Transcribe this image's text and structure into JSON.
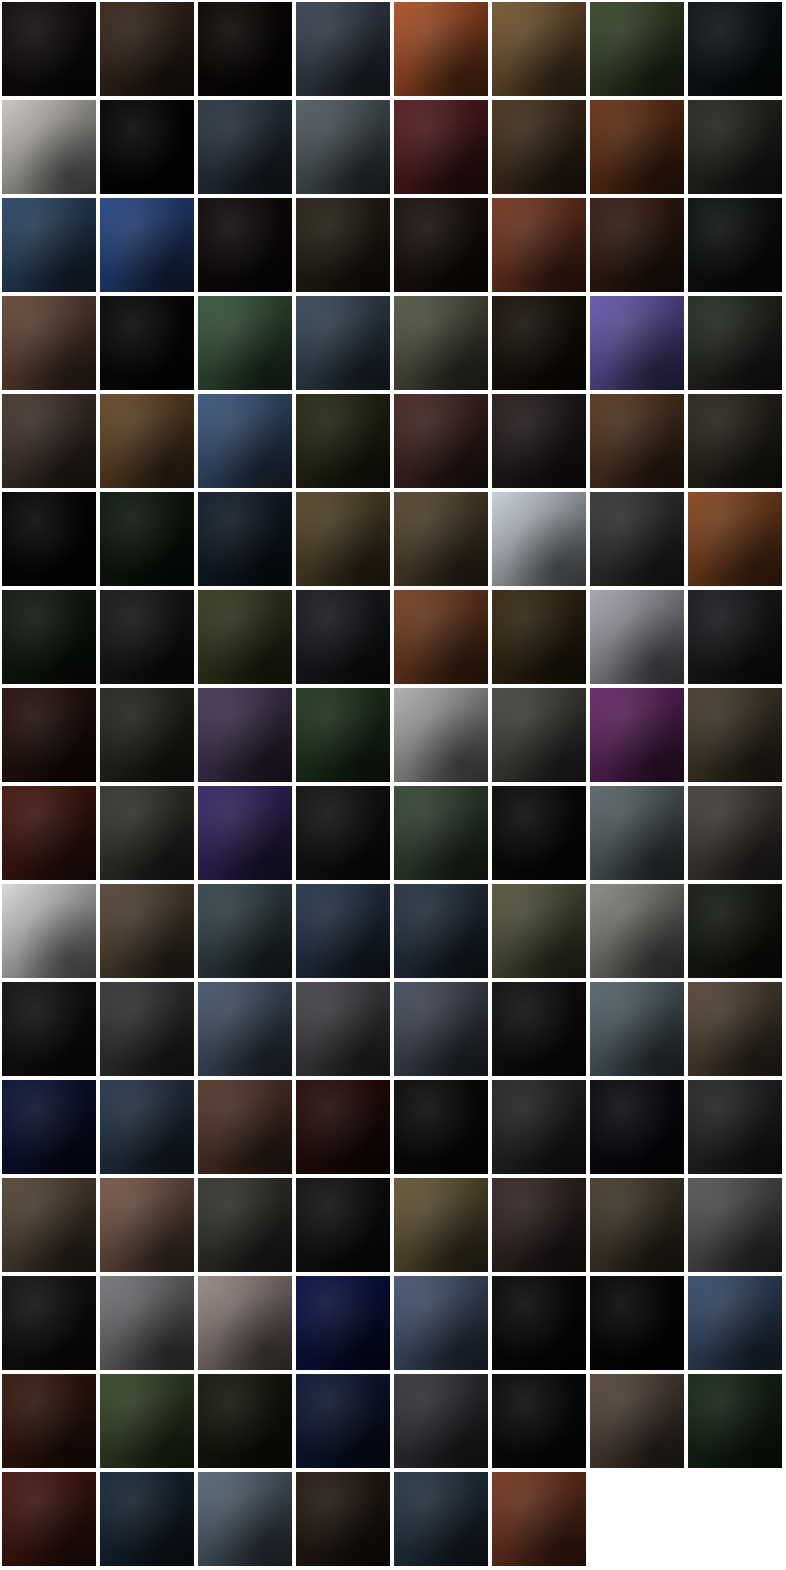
{
  "grid": {
    "rows": 16,
    "columns": 8,
    "tile_count": 126,
    "separator_color": "#ffffff",
    "tile_colors": [
      [
        "#140f10",
        "#3b2a1f",
        "#0c0806",
        "#3c4655",
        "#b0542a",
        "#7a5a34",
        "#3c4a2c",
        "#10161a"
      ],
      [
        "#c9c6c2",
        "#050505",
        "#2e3a48",
        "#556066",
        "#5a1f22",
        "#4a3520",
        "#6a3518",
        "#2a2a26"
      ],
      [
        "#2e4a6a",
        "#2a4a8a",
        "#120c0c",
        "#2a2418",
        "#1e1410",
        "#7a3a24",
        "#3a2014",
        "#101410"
      ],
      [
        "#6a4a3a",
        "#0a0808",
        "#3a5a3e",
        "#3a4c5c",
        "#5a5a4a",
        "#1c140c",
        "#6a5ab0",
        "#2a2e28"
      ],
      [
        "#4a3a32",
        "#6a4a2a",
        "#3e5a80",
        "#2a2c16",
        "#4a2a26",
        "#2a2020",
        "#5a3a24",
        "#2e2a20"
      ],
      [
        "#060606",
        "#101a10",
        "#14202e",
        "#5a4a2c",
        "#5a4a32",
        "#c8d0d8",
        "#3a3a3a",
        "#8a4a22"
      ],
      [
        "#141c12",
        "#1a1a18",
        "#3a3e22",
        "#1c1e22",
        "#7a4224",
        "#3a2c14",
        "#a6a6b0",
        "#1e1e22"
      ],
      [
        "#2a1410",
        "#2a2a24",
        "#4a3a5a",
        "#243a22",
        "#b0b0ae",
        "#4a4a46",
        "#6a2a6a",
        "#4a4030"
      ],
      [
        "#4a1a14",
        "#3a3a36",
        "#3a2a6a",
        "#141614",
        "#3a4a3a",
        "#0c0c0a",
        "#5e6a6e",
        "#4a4440"
      ],
      [
        "#d8d8d6",
        "#5a4a3a",
        "#3a4a50",
        "#2a3a50",
        "#2a3848",
        "#5a5a42",
        "#8a8a86",
        "#1a1e16"
      ],
      [
        "#141414",
        "#3a3a3c",
        "#4a5a70",
        "#4a4a4e",
        "#4a5060",
        "#121212",
        "#5a6a72",
        "#5a4a3a"
      ],
      [
        "#0c1438",
        "#2a3a4e",
        "#5a3a2e",
        "#2a0e0c",
        "#0c0c0c",
        "#2a2a2a",
        "#0c0c14",
        "#2a2a2a"
      ],
      [
        "#5a4a3a",
        "#7a5a4a",
        "#3a3a36",
        "#141414",
        "#6a5a3a",
        "#3a2a2a",
        "#4a4030",
        "#5a5a58"
      ],
      [
        "#141414",
        "#7a7a7e",
        "#9a8a86",
        "#0c1448",
        "#4a5a78",
        "#0a0a0a",
        "#060606",
        "#3a5070"
      ],
      [
        "#3a1a10",
        "#3a4a2a",
        "#1a1a10",
        "#101a3a",
        "#3a3a40",
        "#0c0c0c",
        "#5a4a40",
        "#1a2a1a"
      ],
      [
        "#4a1a14",
        "#1a2a3a",
        "#5a6a7a",
        "#2a1e16",
        "#2a3a4a",
        "#7a3a24",
        "#0a0a0a",
        "#0a0a0a"
      ]
    ]
  }
}
